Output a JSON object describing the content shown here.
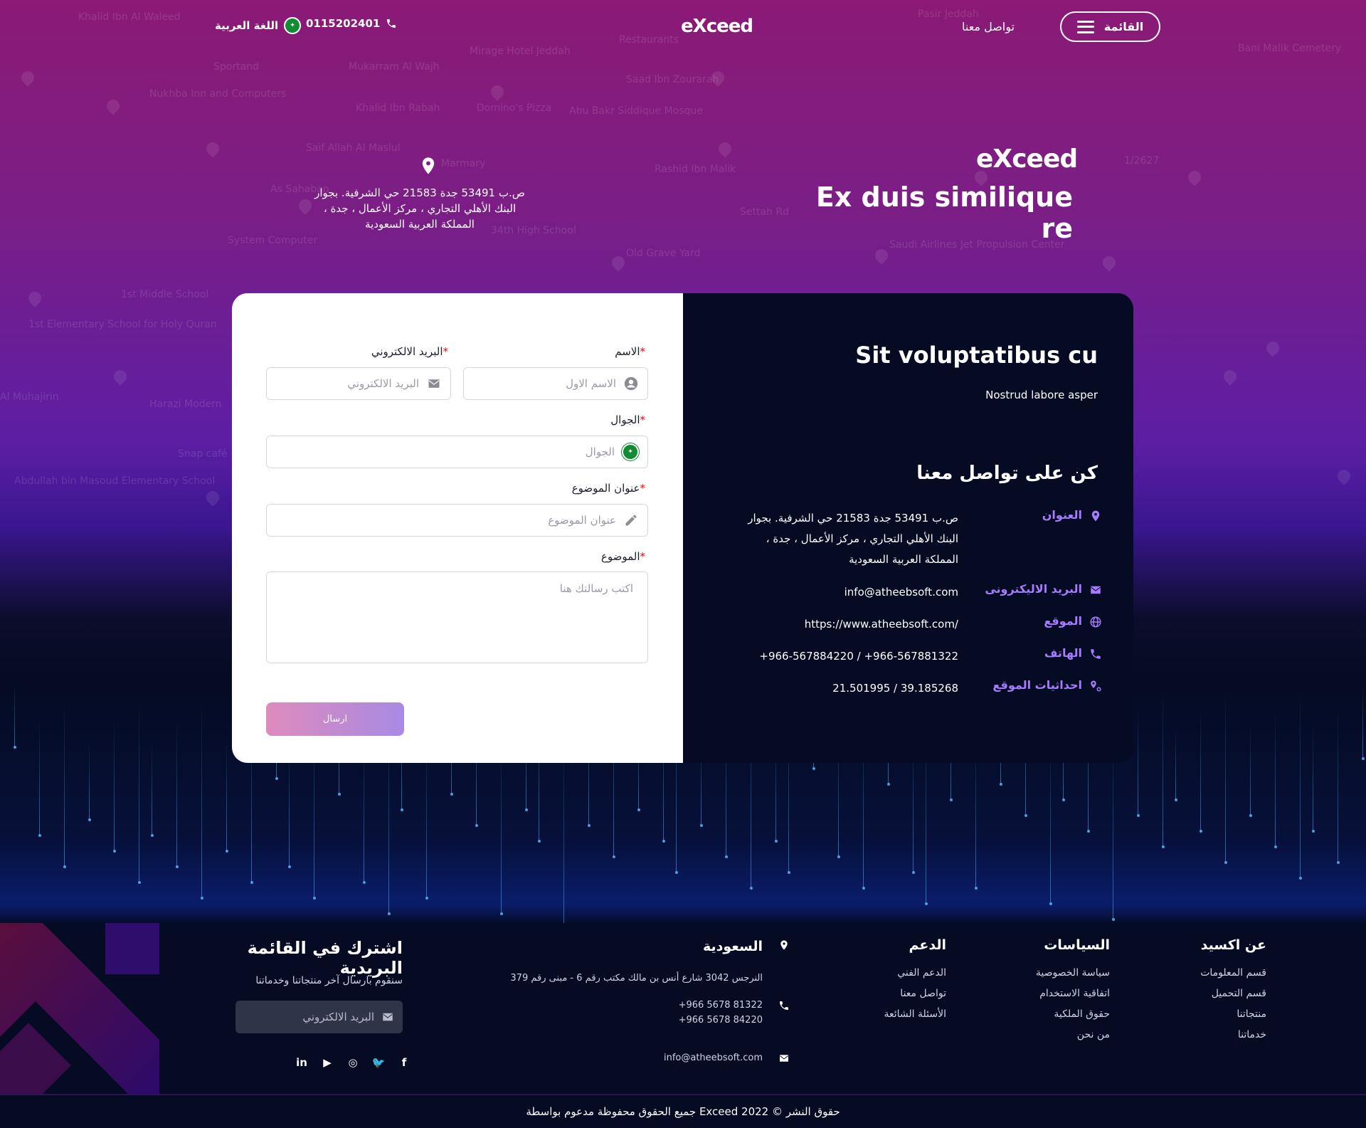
{
  "header": {
    "menu_label": "القائمة",
    "contact_label": "تواصل معنا",
    "logo": {
      "prefix": "e",
      "x": "X",
      "suffix": "ceed"
    },
    "phone": "0115202401",
    "language": "اللغة العربية"
  },
  "hero": {
    "title": "Ex duis similique re",
    "address": "ص.ب 53491 جدة 21583 حي الشرفية. بجوار البنك الأهلي التجاري ، مركز الأعمال ، جدة ، المملكة العربية السعودية"
  },
  "map_labels": [
    "Khalid Ibn Al Waleed",
    "Restaurants",
    "Pasir Jeddah",
    "Mirage Hotel Jeddah",
    "Bani Malik Cemetery",
    "Sportand",
    "Mukarram Al Wajh",
    "Saad Ibn Zourarah",
    "Nukhba Inn and Computers",
    "Khalid Ibn Rabah",
    "Domino's Pizza",
    "Abu Bakr Siddique Mosque",
    "Saif Allah Al Maslul",
    "Rashid Ibn Malik",
    "As Sahaban",
    "Marmary",
    "1/2627",
    "System Computer",
    "34th High School",
    "Saudi Airlines Jet Propulsion Center",
    "Old Grave Yard",
    "1st Middle School",
    "1st Elementary School for Holy Quran",
    "Al Muhajirin",
    "Harazi Modern",
    "Snap café",
    "Abdullah bin Masoud Elementary School",
    "Settah Rd"
  ],
  "form": {
    "name_label": "الاسم",
    "name_placeholder": "الاسم الاول",
    "email_label": "البريد الالكتروني",
    "email_placeholder": "البريد الالكتروني",
    "mobile_label": "الجوال",
    "mobile_placeholder": "الجوال",
    "subject_title_label": "عنوان الموضوع",
    "subject_title_placeholder": "عنوان الموضوع",
    "subject_label": "الموضوع",
    "subject_placeholder": "اكتب رسالتك هنا",
    "required_mark": "*",
    "submit_label": "ارسال"
  },
  "info": {
    "title": "Sit voluptatibus cu",
    "subtitle": "Nostrud labore asper",
    "heading": "كن على تواصل معنا",
    "rows": [
      {
        "label": "العنوان",
        "icon": "location-pin-icon",
        "value": "ص.ب 53491 جدة 21583 حي الشرفية. بجوار البنك الأهلي التجاري ، مركز الأعمال ، جدة ، المملكة العربية السعودية"
      },
      {
        "label": "البريد الاليكترونى",
        "icon": "envelope-icon",
        "value": "info@atheebsoft.com"
      },
      {
        "label": "الموقع",
        "icon": "globe-icon",
        "value": "https://www.atheebsoft.com/"
      },
      {
        "label": "الهاتف",
        "icon": "phone-icon",
        "value": "+966-567884220 / +966-567881322"
      },
      {
        "label": "احداثيات الموقع",
        "icon": "coordinates-pin-icon",
        "value": "21.501995 / 39.185268"
      }
    ]
  },
  "footer": {
    "about": {
      "title": "عن اكسيد",
      "links": [
        "قسم المعلومات",
        "قسم التحميل",
        "منتجاتنا",
        "خدماتنا"
      ]
    },
    "policies": {
      "title": "السياسات",
      "links": [
        "سياسة الخصوصية",
        "اتفاقية الاستخدام",
        "حقوق الملكية",
        "من نحن"
      ]
    },
    "support": {
      "title": "الدعم",
      "links": [
        "الدعم الفني",
        "تواصل معنا",
        "الأسئلة الشائعة"
      ]
    },
    "country": {
      "title": "السعودية",
      "address": "النرجس 3042 شارع أنس بن مالك مكتب رقم 6 - مبنى رقم 379",
      "phone_1": "+966 5678 81322",
      "phone_2": "+966 5678 84220",
      "email": "info@atheebsoft.com"
    },
    "newsletter": {
      "title": "اشترك في القائمة البريدية",
      "description": "سنقوم بارسال آخر منتجاتنا وخدماتنا",
      "placeholder": "البريد الالكتروني"
    },
    "socials": [
      {
        "name": "linkedin-icon",
        "glyph": "in"
      },
      {
        "name": "youtube-icon",
        "glyph": "▶"
      },
      {
        "name": "instagram-icon",
        "glyph": "◎"
      },
      {
        "name": "twitter-icon",
        "glyph": "🐦"
      },
      {
        "name": "facebook-icon",
        "glyph": "f"
      }
    ],
    "copyright": "حقوق النشر © Exceed 2022 جميع الحقوق محفوظة مدعوم بواسطة"
  },
  "colors": {
    "accent": "#a67bff",
    "hero_top": "#8c1a76",
    "hero_mid": "#5d1ea4",
    "dark": "#050b22",
    "button_from": "#de8bbd",
    "button_to": "#a88ae4",
    "flag_green": "#128c33"
  }
}
